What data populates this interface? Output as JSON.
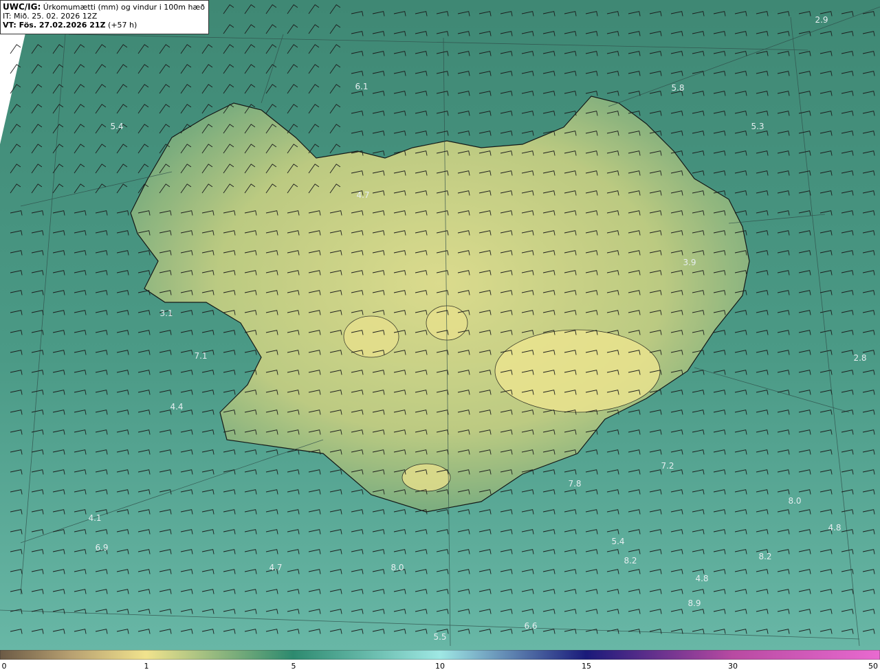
{
  "header": {
    "product": "UWC/IG:",
    "title": "Úrkomumætti (mm) og vindur i 100m hæð",
    "init_time": "IT: Mið. 25. 02. 2026 12Z",
    "valid_label": "VT: Fös. 27.02.2026 21Z",
    "valid_offset": "(+57 h)"
  },
  "colorbar": {
    "ticks": [
      "0",
      "1",
      "5",
      "10",
      "15",
      "30",
      "50"
    ],
    "colors": [
      "#6b5a45",
      "#b7a071",
      "#f1e38d",
      "#2d8a6f",
      "#9fe8e4",
      "#1a1a7a",
      "#b84aa2",
      "#e96ad0"
    ]
  },
  "map": {
    "ocean_color": "#3e8a76",
    "land_color": "#d6d98a",
    "coastline_color": "#111111",
    "values": [
      "2.9",
      "6.1",
      "5.8",
      "5.4",
      "5.3",
      "4.7",
      "3.9",
      "3.1",
      "7.1",
      "2.8",
      "4.4",
      "7.2",
      "7.8",
      "8.0",
      "4.1",
      "4.8",
      "6.9",
      "5.4",
      "4.7",
      "8.0",
      "8.2",
      "8.2",
      "4.8",
      "8.9",
      "6.6",
      "5.5"
    ]
  }
}
